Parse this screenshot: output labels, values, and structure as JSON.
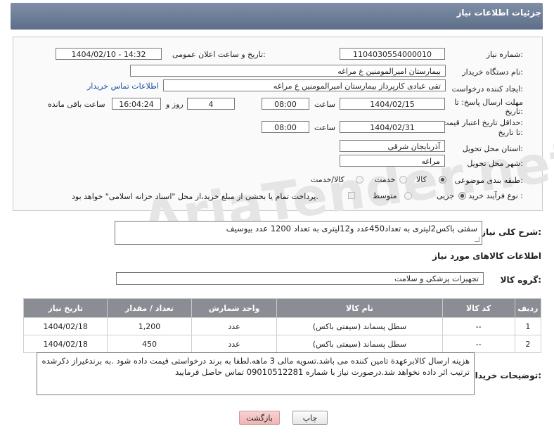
{
  "header": {
    "title": "جزئیات اطلاعات نیاز"
  },
  "form": {
    "need_number_label": "شماره نیاز:",
    "need_number": "1104030554000010",
    "announce_label": "تاریخ و ساعت اعلان عمومی:",
    "announce_value": "1404/02/10 - 14:32",
    "buyer_label": "نام دستگاه خریدار:",
    "buyer_value": "بیمارستان امیرالمومنین ع  مراغه",
    "requester_label": "ایجاد کننده درخواست:",
    "requester_value": "تقی عبادی کارپرداز بیمارستان امیرالمومنین ع  مراغه",
    "contact_link": "اطلاعات تماس خریدار",
    "deadline_label_1": "مهلت ارسال پاسخ: تا",
    "deadline_label_2": "تاریخ:",
    "deadline_date": "1404/02/15",
    "time_label": "ساعت",
    "deadline_time": "08:00",
    "days_value": "4",
    "days_label": "روز و",
    "remaining_time": "16:04:24",
    "remaining_label": "ساعت باقی مانده",
    "validity_label_1": "حداقل تاریخ اعتبار قیمت:",
    "validity_label_2": "تا تاریخ:",
    "validity_date": "1404/02/31",
    "validity_time": "08:00",
    "province_label": "استان محل تحویل:",
    "province_value": "آذربایجان شرقی",
    "city_label": "شهر محل تحویل:",
    "city_value": "مراغه",
    "category_label": "طبقه بندی موضوعی:",
    "category_options": [
      "کالا",
      "خدمت",
      "کالا/خدمت"
    ],
    "process_label": "نوع فرآیند خرید :",
    "process_options": [
      "جزیی",
      "متوسط"
    ],
    "payment_note": "پرداخت تمام یا بخشی از مبلغ خرید،از محل \"اسناد خزانه اسلامی\" خواهد بود."
  },
  "description": {
    "label": "شرح کلی نیاز:",
    "value": "سفتی باکس2لیتری به تعداد450عدد و12لیتری به تعداد 1200 عدد بیوسیف"
  },
  "goods": {
    "section_title": "اطلاعات کالاهای مورد نیاز",
    "group_label": "گروه کالا:",
    "group_value": "تجهیزات پزشکی و سلامت",
    "columns": [
      "ردیف",
      "کد کالا",
      "نام کالا",
      "واحد شمارش",
      "تعداد / مقدار",
      "تاریخ نیاز"
    ],
    "rows": [
      {
        "index": "1",
        "code": "--",
        "name": "سطل پسماند (سیفتی باکس)",
        "unit": "عدد",
        "qty": "1,200",
        "date": "1404/02/18"
      },
      {
        "index": "2",
        "code": "--",
        "name": "سطل پسماند (سیفتی باکس)",
        "unit": "عدد",
        "qty": "450",
        "date": "1404/02/18"
      }
    ]
  },
  "buyer_notes": {
    "label": "توضیحات خریدار:",
    "value": "هزینه ارسال کالابرعهدة تامین کننده می باشد.تسویه مالی 3 ماهه.لطفا به برند درخواستی قیمت داده شود .به برندغیراز ذکرشده ترتیب اثر داده نخواهد شد.درصورت نیاز با شماره 09010512281 تماس حاصل فرمایید"
  },
  "buttons": {
    "print": "چاپ",
    "back": "بازگشت"
  },
  "watermark": "AriaTender.net",
  "colors": {
    "header": "#6b7b95",
    "table_header": "#8a8d93",
    "link": "#1a4fa0",
    "back_button": "#eeb5b5"
  }
}
